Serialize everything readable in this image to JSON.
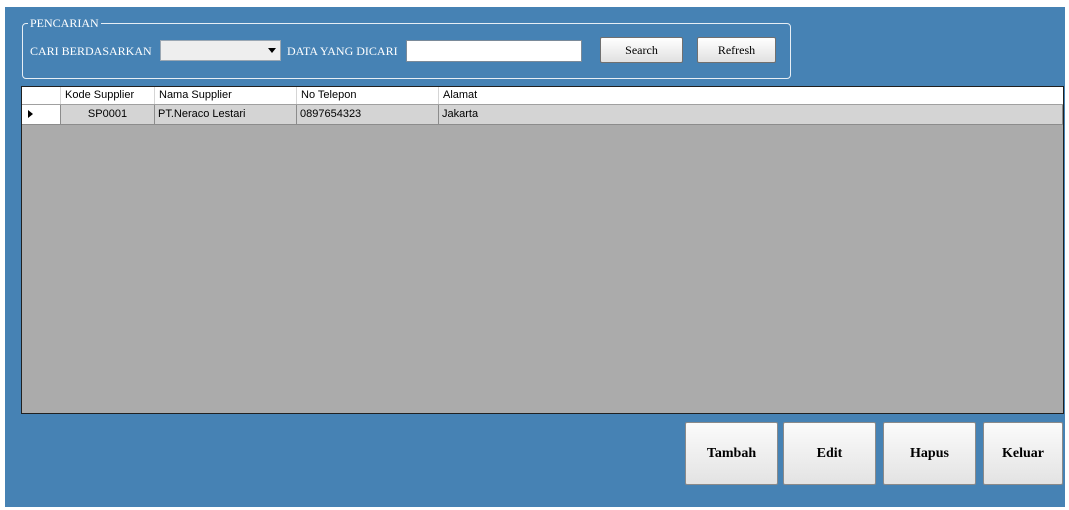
{
  "search_group": {
    "title": "PENCARIAN",
    "search_by_label": "CARI BERDASARKAN",
    "search_by_value": "",
    "search_text_label": "DATA YANG DICARI",
    "search_text_value": "",
    "search_button": "Search",
    "refresh_button": "Refresh"
  },
  "grid": {
    "columns": [
      "Kode Supplier",
      "Nama Supplier",
      "No Telepon",
      "Alamat"
    ],
    "rows": [
      [
        "SP0001",
        "PT.Neraco Lestari",
        "0897654323",
        "Jakarta"
      ]
    ]
  },
  "actions": {
    "add": "Tambah",
    "edit": "Edit",
    "delete": "Hapus",
    "exit": "Keluar"
  },
  "colors": {
    "background": "#4682b4",
    "grid_background": "#ababab"
  }
}
